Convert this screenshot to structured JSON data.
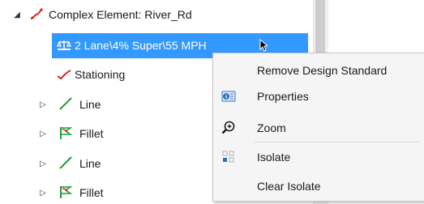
{
  "tree": {
    "root": {
      "label": "Complex Element: River_Rd",
      "expanded": true
    },
    "children": [
      {
        "label": "2 Lane\\4% Super\\55 MPH",
        "icon": "design-standard-icon",
        "selected": true
      },
      {
        "label": "Stationing",
        "icon": "stationing-icon"
      },
      {
        "label": "Line",
        "icon": "line-icon",
        "expandable": true
      },
      {
        "label": "Fillet",
        "icon": "fillet-icon",
        "expandable": true
      },
      {
        "label": "Line",
        "icon": "line-icon",
        "expandable": true
      },
      {
        "label": "Fillet",
        "icon": "fillet-icon",
        "expandable": true
      }
    ]
  },
  "context_menu": {
    "items": [
      {
        "label": "Remove Design Standard",
        "icon": ""
      },
      {
        "label": "Properties",
        "icon": "properties-icon"
      },
      {
        "label": "Zoom",
        "icon": "zoom-icon"
      },
      {
        "label": "Isolate",
        "icon": "isolate-icon"
      },
      {
        "label": "Clear Isolate",
        "icon": ""
      }
    ]
  },
  "colors": {
    "selection": "#3399ff",
    "curve_red": "#d9261c",
    "line_green": "#1e9e3a"
  }
}
